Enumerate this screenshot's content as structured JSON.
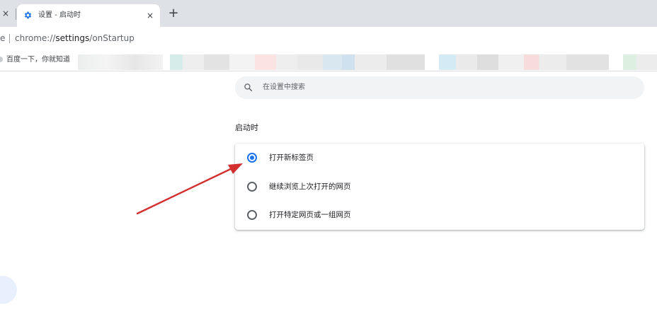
{
  "tabs": {
    "prev_tab_close": "×",
    "active_title": "设置 - 启动时",
    "active_close": "×",
    "new_tab": "+"
  },
  "omnibox": {
    "prefix": "e",
    "url_host": "chrome://",
    "url_bold": "settings",
    "url_path": "/onStartup"
  },
  "bookmarks": {
    "first_label": "百度一下，你就知道"
  },
  "settings": {
    "search_placeholder": "在设置中搜索",
    "section_title": "启动时",
    "options": [
      {
        "label": "打开新标签页",
        "selected": true
      },
      {
        "label": "继续浏览上次打开的网页",
        "selected": false
      },
      {
        "label": "打开特定网页或一组网页",
        "selected": false
      }
    ]
  },
  "colors": {
    "accent": "#1a73e8",
    "annotation_arrow": "#d32f2f"
  }
}
